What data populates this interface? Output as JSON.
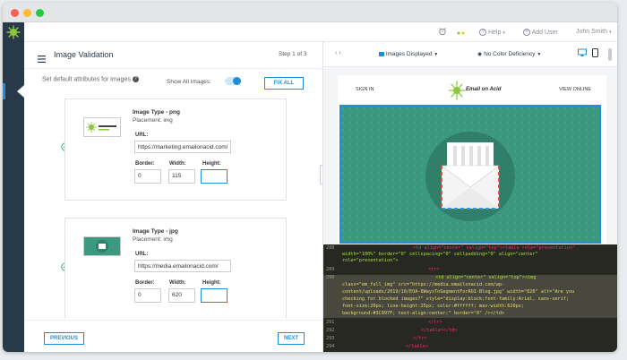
{
  "topbar": {
    "help_label": "Help",
    "add_user_label": "Add User",
    "user_name": "John Smith"
  },
  "panel": {
    "title": "Image Validation",
    "step": "Step 1 of 3",
    "default_attr_text": "Set default attributes for images",
    "show_all_label": "Show All Images:",
    "fix_all_label": "FIX ALL",
    "previous_label": "PREVIOUS",
    "next_label": "NEXT"
  },
  "images": [
    {
      "type": "Image Type - png",
      "placement": "Placement: img",
      "url_label": "URL:",
      "url": "https://marketing.emailonacid.com/",
      "border_label": "Border:",
      "width_label": "Width:",
      "height_label": "Height:",
      "border": "0",
      "width": "115",
      "height": ""
    },
    {
      "type": "Image Type - jpg",
      "placement": "Placement: img",
      "url_label": "URL:",
      "url": "https://media.emailonacid.com/",
      "border_label": "Border:",
      "width_label": "Width:",
      "height_label": "Height:",
      "border": "0",
      "width": "620",
      "height": ""
    }
  ],
  "preview_bar": {
    "images_displayed": "Images Displayed",
    "color_deficiency": "No Color Deficiency"
  },
  "email_preview": {
    "sign_in": "SIGN IN",
    "view_online": "VIEW ONLINE",
    "logo_text": "Email on Acid"
  },
  "code": {
    "line_288": "288",
    "line_288_text": "<td align=\"center\" valign=\"top\"><table role=\"presentation\"",
    "line_288_cont": "width=\"100%\" border=\"0\" cellspacing=\"0\" cellpadding=\"0\" align=\"center\"",
    "line_288_cont2": "role=\"presentation\">",
    "line_289": "289",
    "line_289_text": "<tr>",
    "line_290": "290",
    "line_290_text": "<td align=\"center\" valign=\"top\"><img",
    "line_290_c1": "class=\"em_full_img\" src=\"https://media.emailonacid.com/wp-",
    "line_290_c2": "content/uploads/2019/10/EOA-8WaysToSegmentForROI-Blog.jpg\" width=\"620\" alt=\"Are you",
    "line_290_c3": "checking for blocked images?\" style=\"display:block;font-family:Arial, sans-serif;",
    "line_290_c4": "font-size:20px; line-height:25px; color:#ffffff; max-width:620px;",
    "line_290_c5": "background:#3C997F; text-align:center;\" border=\"0\" /></td>",
    "line_291": "291",
    "line_291_text": "</tr>",
    "line_292": "292",
    "line_292_text": "</table></td>",
    "line_293": "293",
    "line_293_text": "</tr>",
    "line_294": "294",
    "line_294_text": "</table>"
  },
  "colors": {
    "accent": "#1f8fd6",
    "sidebar": "#283a4a",
    "preview_green": "#3C997F",
    "check_green": "#27ae60"
  }
}
